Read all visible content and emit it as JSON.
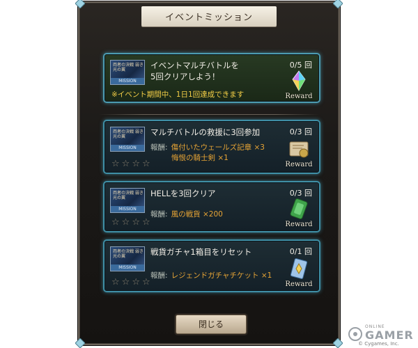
{
  "dialog": {
    "title": "イベントミッション",
    "close_button": "閉じる"
  },
  "missions": [
    {
      "title_line1": "イベントマルチバトルを",
      "title_line2": "5回クリアしよう！",
      "count": "0/5 回",
      "note": "※イベント期間中、1日1回達成できます",
      "reward_word": "Reward",
      "thumb_label": "MISSION",
      "thumb_text": "両者の決戦 弱き光の翼",
      "icon": "rainbow-crystal-icon"
    },
    {
      "title_line1": "マルチバトルの救援に3回参加",
      "count": "0/3 回",
      "reward_label": "報酬:",
      "reward_line1": "傷付いたウェールズ記章 ×3",
      "reward_line2": "悔恨の騎士剣 ×1",
      "reward_word": "Reward",
      "thumb_label": "MISSION",
      "thumb_text": "両者の決戦 弱き光の翼",
      "icon": "scroll-emblem-icon"
    },
    {
      "title_line1": "HELLを3回クリア",
      "count": "0/3 回",
      "reward_label": "報酬:",
      "reward_line1": "風の戦貨 ×200",
      "reward_word": "Reward",
      "thumb_label": "MISSION",
      "thumb_text": "両者の決戦 弱き光の翼",
      "icon": "green-coin-icon"
    },
    {
      "title_line1": "戦貨ガチャ1箱目をリセット",
      "count": "0/1 回",
      "reward_label": "報酬:",
      "reward_line1": "レジェンドガチャチケット ×1",
      "reward_word": "Reward",
      "thumb_label": "MISSION",
      "thumb_text": "両者の決戦 弱き光の翼",
      "icon": "gacha-ticket-icon"
    }
  ],
  "watermark": {
    "online": "ONLINE",
    "gamer": "GAMER",
    "copyright": "© Cygames, Inc."
  },
  "colors": {
    "accent_border": "#3f8fa6",
    "reward_text": "#e8a535",
    "note_text": "#f2cd46"
  }
}
